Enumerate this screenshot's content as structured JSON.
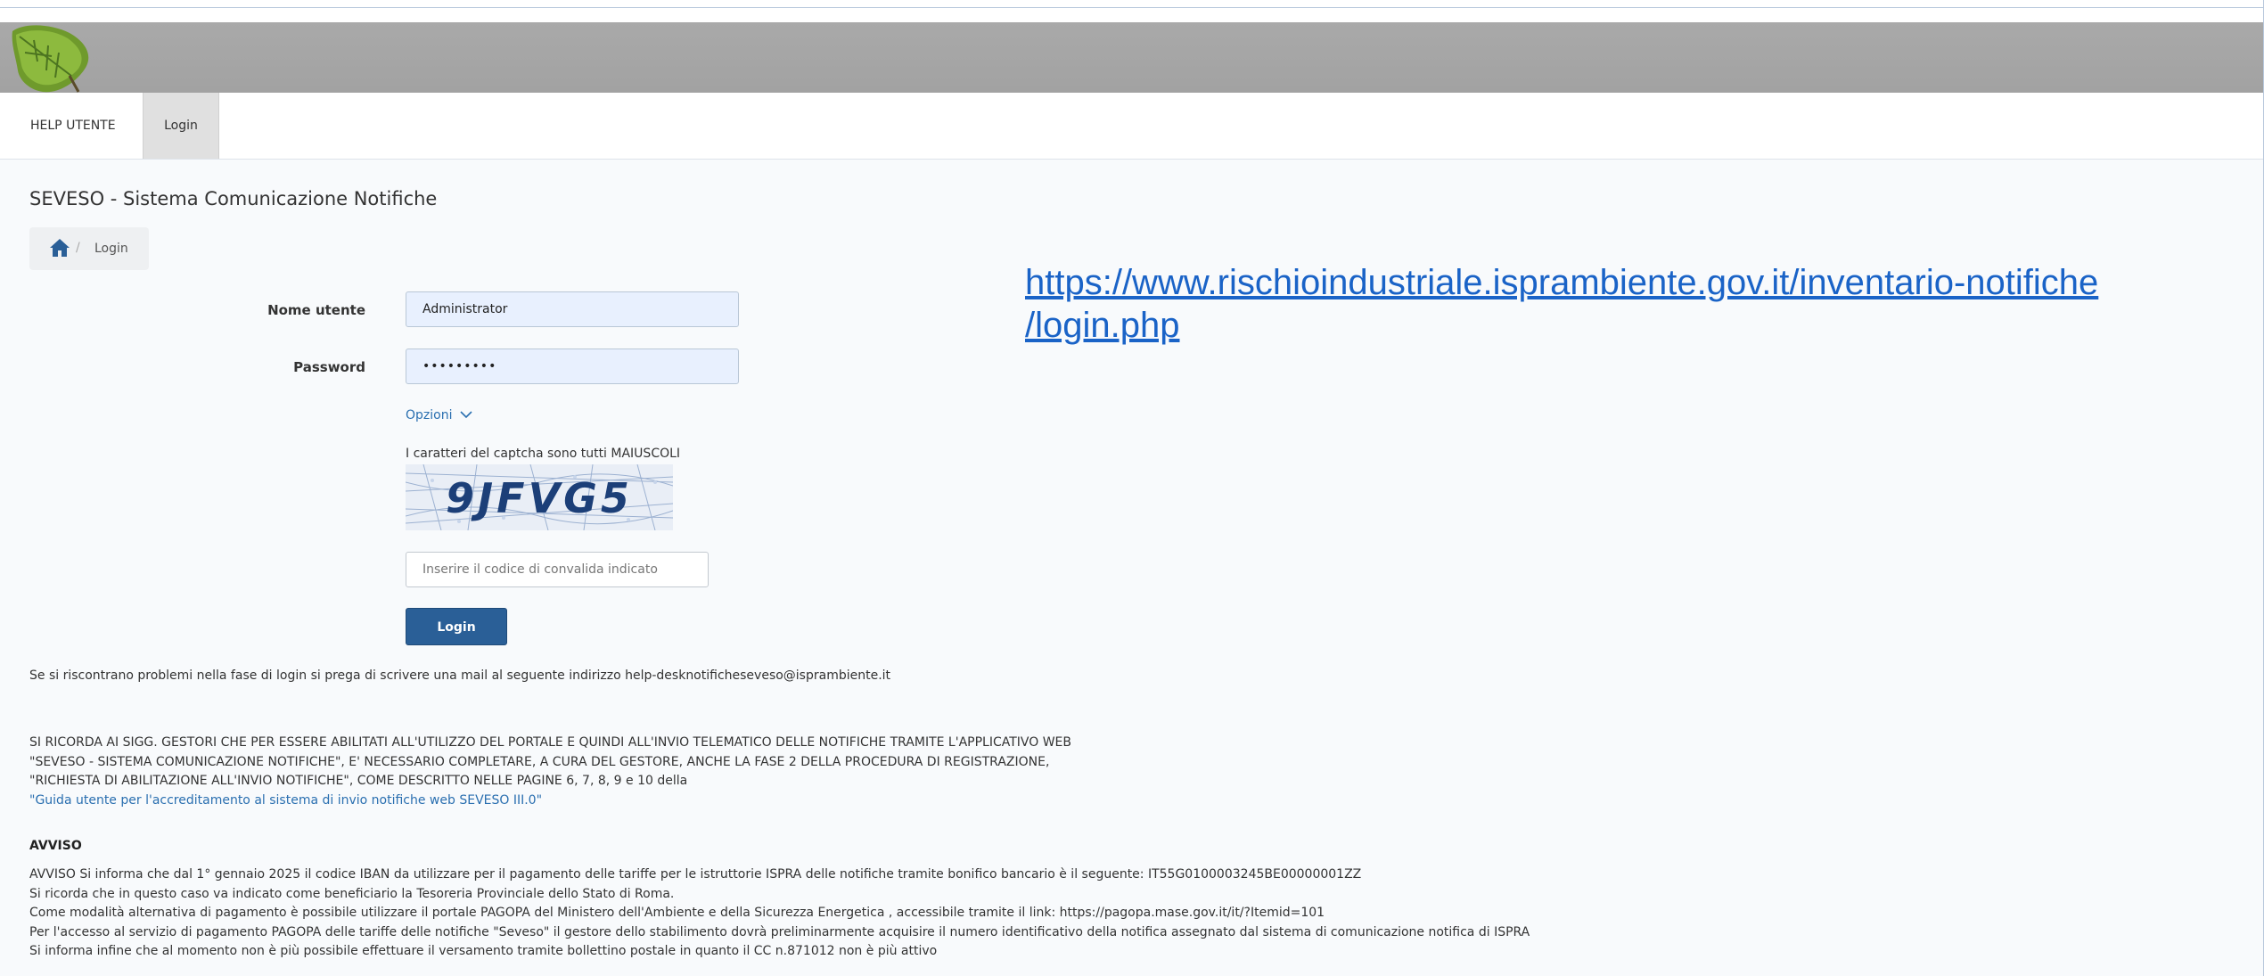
{
  "nav": {
    "help": "HELP UTENTE",
    "login": "Login"
  },
  "page": {
    "title": "SEVESO - Sistema Comunicazione Notifiche"
  },
  "breadcrumb": {
    "current": "Login"
  },
  "form": {
    "username_label": "Nome utente",
    "username_value": "Administrator",
    "password_label": "Password",
    "password_value": "•••••••••",
    "options_label": "Opzioni",
    "captcha_note": "I caratteri del captcha sono tutti MAIUSCOLI",
    "captcha_text": "9JFVG5",
    "captcha_placeholder": "Inserire il codice di convalida indicato",
    "login_button": "Login"
  },
  "url_overlay": {
    "line1": "https://www.rischioindustriale.isprambiente.gov.it/inventario-notifiche",
    "line2": "/login.php"
  },
  "help_line": "Se si riscontrano problemi nella fase di login si prega di scrivere una mail al seguente indirizzo help-desknotificheseveso@isprambiente.it",
  "notice": {
    "line1": "SI RICORDA AI SIGG. GESTORI CHE PER ESSERE ABILITATI ALL'UTILIZZO DEL PORTALE E QUINDI ALL'INVIO TELEMATICO DELLE NOTIFICHE TRAMITE L'APPLICATIVO WEB",
    "line2": "\"SEVESO - SISTEMA COMUNICAZIONE NOTIFICHE\", E' NECESSARIO COMPLETARE, A CURA DEL GESTORE, ANCHE LA FASE 2 DELLA PROCEDURA DI REGISTRAZIONE,",
    "line3": "\"RICHIESTA DI ABILITAZIONE ALL'INVIO NOTIFICHE\", COME DESCRITTO NELLE PAGINE 6, 7, 8, 9 e 10 della",
    "link": "\"Guida utente per l'accreditamento al sistema di invio notifiche web SEVESO III.0\""
  },
  "avviso": {
    "title": "AVVISO",
    "line1": "AVVISO Si informa che dal 1° gennaio 2025 il codice IBAN da utilizzare per il pagamento delle tariffe per le istruttorie ISPRA delle notifiche tramite bonifico bancario è il seguente: IT55G0100003245BE00000001ZZ",
    "line2": "Si ricorda che in questo caso va indicato come beneficiario la Tesoreria Provinciale dello Stato di Roma.",
    "line3": "Come modalità alternativa di pagamento è possibile utilizzare il portale PAGOPA del Ministero dell'Ambiente e della Sicurezza Energetica , accessibile tramite il link: https://pagopa.mase.gov.it/it/?Itemid=101",
    "line4": "Per l'accesso al servizio di pagamento PAGOPA delle tariffe delle notifiche \"Seveso\" il gestore dello stabilimento dovrà preliminarmente acquisire il numero identificativo della notifica assegnato dal sistema di comunicazione notifica di ISPRA",
    "line5": "Si informa infine che al momento non è più possibile effettuare il versamento tramite bollettino postale in quanto il CC n.871012 non è più attivo"
  },
  "icons": {
    "home": "home-icon",
    "chevron": "chevron-down-icon",
    "logo": "leaf-logo"
  },
  "colors": {
    "primary": "#2a5f97",
    "link": "#2a6fb0",
    "banner": "#a6a6a6",
    "url_overlay": "#1a63c7"
  }
}
